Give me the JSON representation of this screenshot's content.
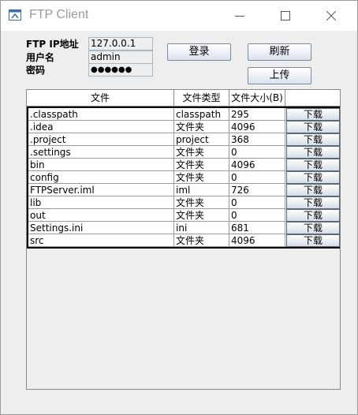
{
  "window": {
    "title": "FTP Client"
  },
  "form": {
    "ip_label": "FTP IP地址",
    "ip_value": "127.0.0.1",
    "user_label": "用户名",
    "user_value": "admin",
    "pass_label": "密码",
    "pass_value": "●●●●●●"
  },
  "buttons": {
    "login": "登录",
    "refresh": "刷新",
    "upload": "上传"
  },
  "table": {
    "columns": [
      "文件",
      "文件类型",
      "文件大小(B)",
      ""
    ],
    "download_label": "下载",
    "rows": [
      {
        "name": ".classpath",
        "type": "classpath",
        "size": "295"
      },
      {
        "name": ".idea",
        "type": "文件夹",
        "size": "4096"
      },
      {
        "name": ".project",
        "type": "project",
        "size": "368"
      },
      {
        "name": ".settings",
        "type": "文件夹",
        "size": "0"
      },
      {
        "name": "bin",
        "type": "文件夹",
        "size": "4096"
      },
      {
        "name": "config",
        "type": "文件夹",
        "size": "0"
      },
      {
        "name": "FTPServer.iml",
        "type": "iml",
        "size": "726"
      },
      {
        "name": "lib",
        "type": "文件夹",
        "size": "0"
      },
      {
        "name": "out",
        "type": "文件夹",
        "size": "0"
      },
      {
        "name": "Settings.ini",
        "type": "ini",
        "size": "681"
      },
      {
        "name": "src",
        "type": "文件夹",
        "size": "4096"
      }
    ]
  }
}
